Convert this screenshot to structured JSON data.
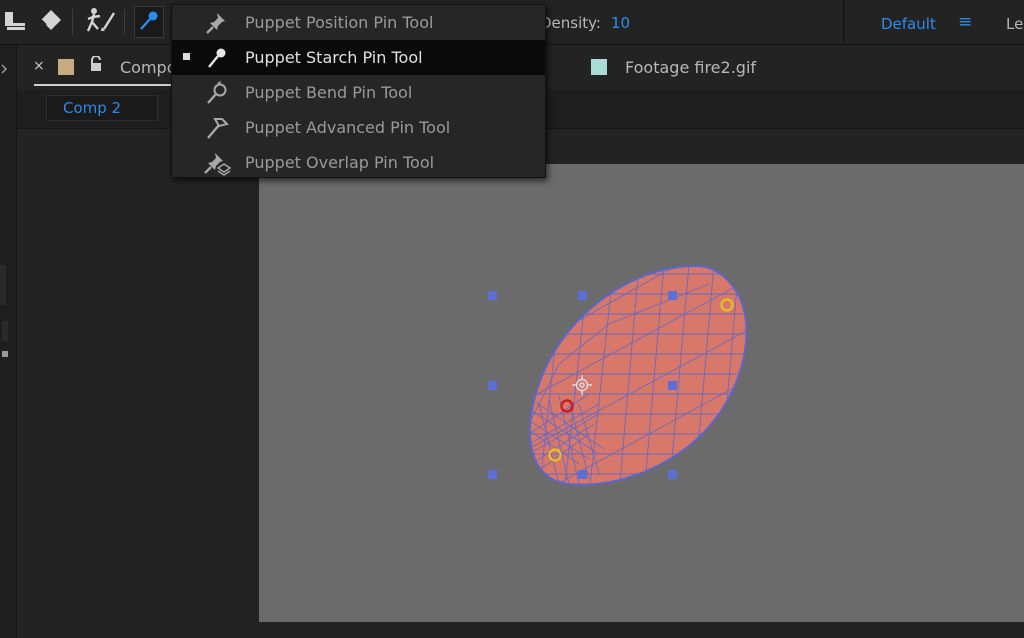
{
  "toolbar": {
    "density_label": "Density:",
    "density_value": "10",
    "workspace": "Default",
    "workspace_menu_glyph": "≡",
    "workspace_next": "Le"
  },
  "tool_menu": {
    "items": [
      {
        "label": "Puppet Position Pin Tool",
        "icon": "pushpin-icon",
        "selected": false
      },
      {
        "label": "Puppet Starch Pin Tool",
        "icon": "starch-pin-icon",
        "selected": true
      },
      {
        "label": "Puppet Bend Pin Tool",
        "icon": "bend-pin-icon",
        "selected": false
      },
      {
        "label": "Puppet Advanced Pin Tool",
        "icon": "advanced-pin-icon",
        "selected": false
      },
      {
        "label": "Puppet Overlap Pin Tool",
        "icon": "overlap-pin-icon",
        "selected": false
      }
    ]
  },
  "panel": {
    "close_glyph": "×",
    "tab_label": "Compo",
    "footage_label": "Footage  fire2.gif",
    "comp_chip": "Comp 2"
  },
  "colors": {
    "accent": "#2d8ceb",
    "mesh_fill": "#d8786b",
    "mesh_stroke": "#5a67c9",
    "handle": "#5b6fd6",
    "pin_yellow": "#e8c020",
    "pin_red": "#d11b1b"
  }
}
